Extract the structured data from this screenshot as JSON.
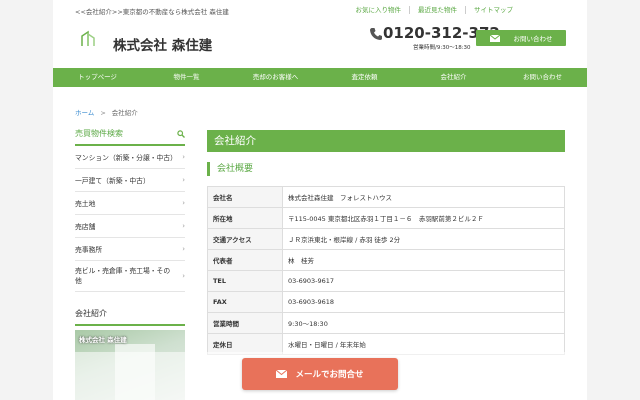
{
  "header": {
    "topnote": "<<会社紹介>>東京都の不動産なら株式会社 森住建",
    "links": [
      "お気に入り物件",
      "最近見た物件",
      "サイトマップ"
    ],
    "company_name": "株式会社 森住建",
    "phone": "0120-312-372",
    "hours": "営業時間/9:30〜18:30",
    "contact_label": "お問い合わせ"
  },
  "nav": {
    "items": [
      "トップページ",
      "物件一覧",
      "売却のお客様へ",
      "査定依頼",
      "会社紹介",
      "お問い合わせ"
    ]
  },
  "breadcrumb": {
    "home": "ホーム",
    "sep": ">",
    "current": "会社紹介"
  },
  "sidebar": {
    "search_title": "売買物件検索",
    "items": [
      "マンション（新築・分譲・中古）",
      "一戸建て（新築・中古）",
      "売土地",
      "売店舗",
      "売事務所",
      "売ビル・売倉庫・売工場・その他"
    ],
    "company_title": "会社紹介",
    "banner_text": "株式会社 森住建"
  },
  "main": {
    "title": "会社紹介",
    "subtitle": "会社概要",
    "rows": [
      {
        "k": "会社名",
        "v": "株式会社森住建　フォレストハウス"
      },
      {
        "k": "所在地",
        "v": "〒115-0045 東京都北区赤羽１丁目１－６　赤羽駅前第２ビル２Ｆ"
      },
      {
        "k": "交通アクセス",
        "v": "ＪＲ京浜東北・根岸線 / 赤羽 徒歩 2分"
      },
      {
        "k": "代表者",
        "v": "林　桂芳"
      },
      {
        "k": "TEL",
        "v": "03-6903-9617"
      },
      {
        "k": "FAX",
        "v": "03-6903-9618"
      },
      {
        "k": "営業時間",
        "v": "9:30〜18:30"
      },
      {
        "k": "定休日",
        "v": "水曜日・日曜日 / 年末年始"
      }
    ]
  },
  "fab": {
    "label": "メールでお問合せ"
  },
  "colors": {
    "accent": "#6bb14a",
    "cta": "#e8725a"
  },
  "icons": [
    "logo-icon",
    "phone-icon",
    "mail-icon",
    "search-icon",
    "chevron-right-icon"
  ]
}
